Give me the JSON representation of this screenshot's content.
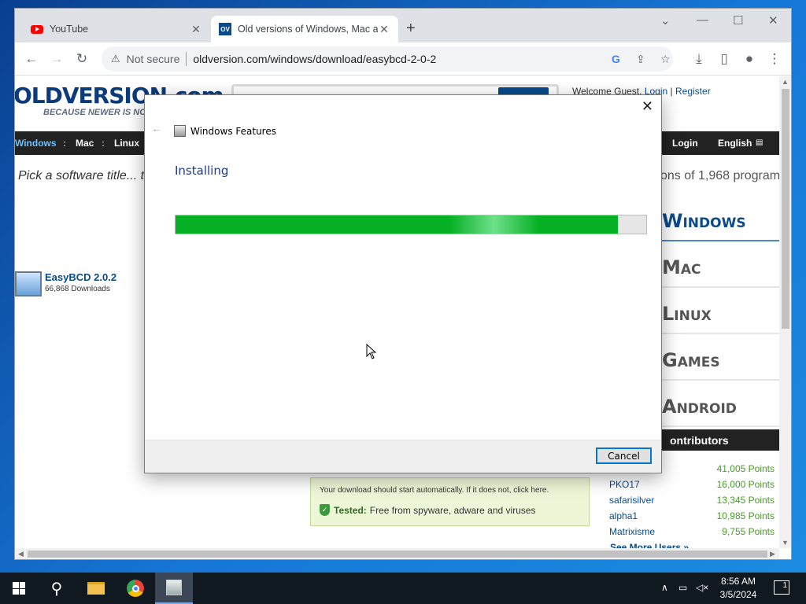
{
  "browser": {
    "tabs": [
      {
        "title": "YouTube",
        "icon": "youtube-icon"
      },
      {
        "title": "Old versions of Windows, Mac an",
        "icon": "oldversion-icon",
        "favicon_text": "OV"
      }
    ],
    "new_tab": "+",
    "address": {
      "security_label": "Not secure",
      "url": "oldversion.com/windows/download/easybcd-2-0-2"
    }
  },
  "site": {
    "logo": "OLDVERSION.com",
    "tagline": "BECAUSE NEWER IS NOT",
    "welcome": "Welcome Guest.",
    "login": "Login",
    "register": "Register",
    "nav": [
      "Windows",
      ":",
      "Mac",
      ":",
      "Linux"
    ],
    "nav_right": [
      "Login",
      "English"
    ],
    "pick_text": "Pick a software title... t",
    "versions_text": "ons of 1,968 program",
    "software": {
      "name": "EasyBCD 2.0.2",
      "downloads": "66,868 Downloads"
    },
    "platforms": [
      "Windows",
      "Mac",
      "Linux",
      "Games",
      "Android"
    ],
    "contributors_heading": "ontributors",
    "contributors": [
      {
        "user": "",
        "points": "41,005 Points"
      },
      {
        "user": "PKO17",
        "points": "16,000 Points"
      },
      {
        "user": "safarisilver",
        "points": "13,345 Points"
      },
      {
        "user": "alpha1",
        "points": "10,985 Points"
      },
      {
        "user": "Matrixisme",
        "points": "9,755 Points"
      }
    ],
    "see_more": "See More Users »",
    "download_msg": "Your download should start automatically. If it does not, click here.",
    "tested_label": "Tested:",
    "tested_text": "Free from spyware, adware and viruses"
  },
  "dialog": {
    "title": "Windows Features",
    "heading": "Installing",
    "progress": 0.94,
    "cancel": "Cancel"
  },
  "taskbar": {
    "time": "8:56 AM",
    "date": "3/5/2024",
    "notifications": "1"
  },
  "colors": {
    "progress_green": "#06b025",
    "desktop_blue": "#1677d6",
    "site_blue": "#0b4a8b"
  }
}
